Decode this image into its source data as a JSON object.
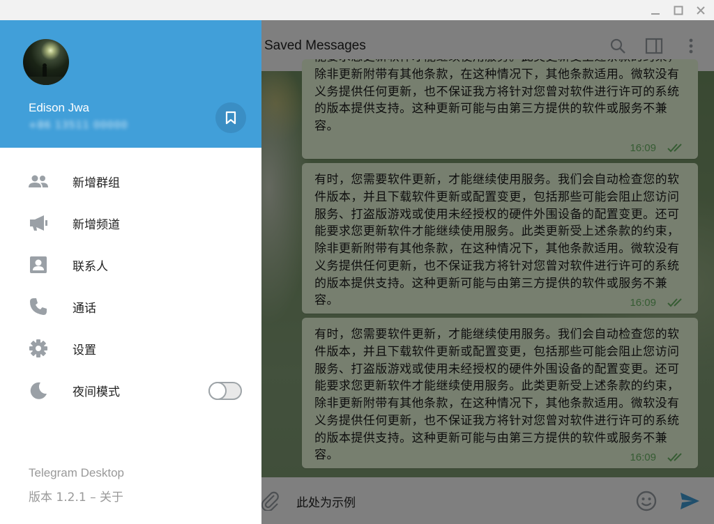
{
  "window": {
    "minimize_glyph": "—",
    "maximize_glyph": "☐",
    "close_glyph": "✕"
  },
  "drawer": {
    "user_name": "Edison Jwa",
    "user_phone": "+86 13511 00000",
    "menu": [
      {
        "label": "新增群组",
        "icon": "group-icon"
      },
      {
        "label": "新增频道",
        "icon": "megaphone-icon"
      },
      {
        "label": "联系人",
        "icon": "contact-icon"
      },
      {
        "label": "通话",
        "icon": "phone-icon"
      },
      {
        "label": "设置",
        "icon": "gear-icon"
      },
      {
        "label": "夜间模式",
        "icon": "moon-icon",
        "toggle": false
      }
    ],
    "footer_app": "Telegram Desktop",
    "footer_version": "版本 1.2.1 – 关于"
  },
  "chat": {
    "title": "Saved Messages",
    "messages": [
      {
        "text": "能要求您更新软件才能继续使用服务。此类更新受上述条款的约束，除非更新附带有其他条款，在这种情况下，其他条款适用。微软没有义务提供任何更新，也不保证我方将针对您曾对软件进行许可的系统的版本提供支持。这种更新可能与由第三方提供的软件或服务不兼容。",
        "time": "16:09"
      },
      {
        "text": "有时，您需要软件更新，才能继续使用服务。我们会自动检查您的软件版本，并且下载软件更新或配置变更，包括那些可能会阻止您访问服务、打盗版游戏或使用未经授权的硬件外围设备的配置变更。还可能要求您更新软件才能继续使用服务。此类更新受上述条款的约束，除非更新附带有其他条款，在这种情况下，其他条款适用。微软没有义务提供任何更新，也不保证我方将针对您曾对软件进行许可的系统的版本提供支持。这种更新可能与由第三方提供的软件或服务不兼容。",
        "time": "16:09"
      },
      {
        "text": "有时，您需要软件更新，才能继续使用服务。我们会自动检查您的软件版本，并且下载软件更新或配置变更，包括那些可能会阻止您访问服务、打盗版游戏或使用未经授权的硬件外围设备的配置变更。还可能要求您更新软件才能继续使用服务。此类更新受上述条款的约束，除非更新附带有其他条款，在这种情况下，其他条款适用。微软没有义务提供任何更新，也不保证我方将针对您曾对软件进行许可的系统的版本提供支持。这种更新可能与由第三方提供的软件或服务不兼容。",
        "time": "16:09"
      }
    ],
    "composer_text": "此处为示例"
  },
  "colors": {
    "drawer_header": "#419fd9",
    "bubble": "#eefedf",
    "check": "#6cb866",
    "send": "#419fd9"
  }
}
